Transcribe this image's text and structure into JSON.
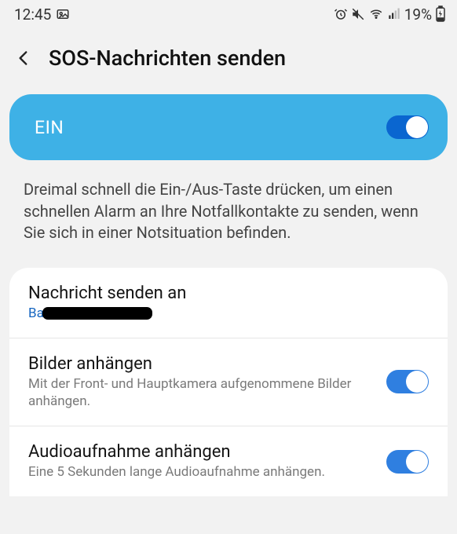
{
  "status": {
    "time": "12:45",
    "battery_text": "19%"
  },
  "header": {
    "title": "SOS-Nachrichten senden"
  },
  "master": {
    "label": "EIN",
    "on": true
  },
  "description": "Dreimal schnell die Ein-/Aus-Taste drücken, um einen schnellen Alarm an Ihre Notfallkontakte zu senden, wenn Sie sich in einer Notsituation befinden.",
  "rows": {
    "send_to": {
      "title": "Nachricht senden an",
      "contact_prefix": "Ba"
    },
    "attach_images": {
      "title": "Bilder anhängen",
      "sub": "Mit der Front- und Hauptkamera aufgenommene Bilder anhängen.",
      "on": true
    },
    "attach_audio": {
      "title": "Audioaufnahme anhängen",
      "sub": "Eine 5 Sekunden lange Audioaufnahme anhängen.",
      "on": true
    }
  }
}
